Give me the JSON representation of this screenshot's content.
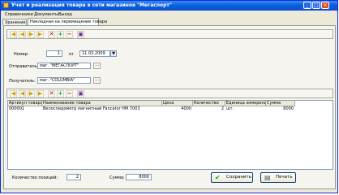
{
  "window": {
    "title": "Учет и реализация товара в сети магазинов \"Мегаспорт\"",
    "minimize": "_",
    "maximize": "□",
    "close": "×"
  },
  "menu": [
    "Справочники",
    "Документы",
    "Выход"
  ],
  "tabs": [
    "Хранение",
    "Накладная на перемещение товара"
  ],
  "form": {
    "number_label": "Номер:",
    "number_value": "1",
    "date_sep_label": "от",
    "date_value": "11.03.2009",
    "sender_label": "Отправитель:",
    "sender_value": "маг. \"МЕГАСПОРТ\"",
    "receiver_label": "Получатель:",
    "receiver_value": "маг. \"COLUMBIA\"",
    "browse_label": "..."
  },
  "toolbar_icons": {
    "first": "◀",
    "prev": "◀",
    "next": "▶",
    "last": "▶",
    "delete": "✕",
    "add": "+",
    "remove": "−",
    "print": "▣"
  },
  "table": {
    "columns": [
      "Артикул товара",
      "Наименование товара",
      "Цена",
      "Количество",
      "Единица измерения",
      "Сумма"
    ],
    "rows": [
      [
        "000001",
        "Велоспидометр магнитный Fancator HM 7003",
        "4000",
        "2",
        "шт.",
        "8000"
      ]
    ]
  },
  "footer": {
    "count_label": "Количество позиций:",
    "count_value": "2",
    "sum_label": "Сумма:",
    "sum_value": "8000",
    "save_label": "Сохранить",
    "print_label": "Печать",
    "save_icon": "✔",
    "print_icon": "▤"
  }
}
